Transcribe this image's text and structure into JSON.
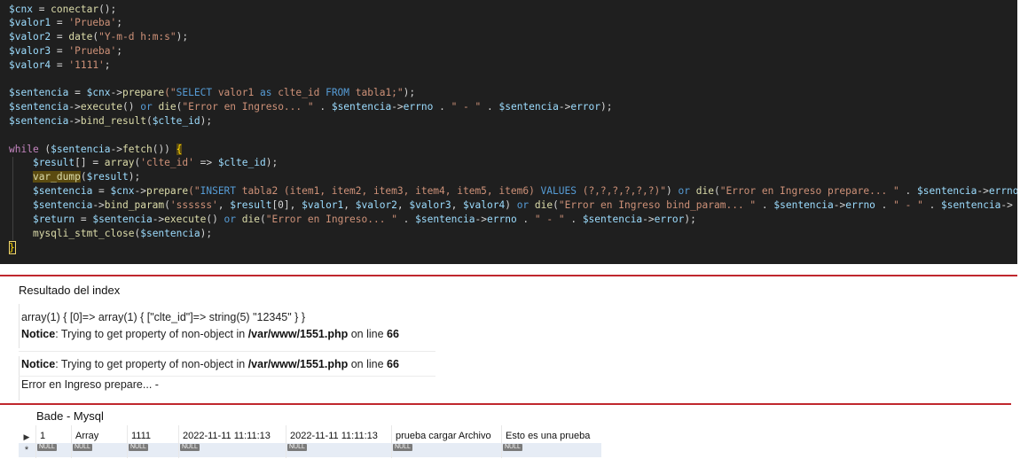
{
  "editor": {
    "lines": {
      "l1": [
        {
          "t": "$cnx",
          "c": "v"
        },
        {
          "t": " = ",
          "c": "o"
        },
        {
          "t": "conectar",
          "c": "f"
        },
        {
          "t": "();",
          "c": "o"
        }
      ],
      "l2": [
        {
          "t": "$valor1",
          "c": "v"
        },
        {
          "t": " = ",
          "c": "o"
        },
        {
          "t": "'Prueba'",
          "c": "s"
        },
        {
          "t": ";",
          "c": "o"
        }
      ],
      "l3": [
        {
          "t": "$valor2",
          "c": "v"
        },
        {
          "t": " = ",
          "c": "o"
        },
        {
          "t": "date",
          "c": "f"
        },
        {
          "t": "(",
          "c": "o"
        },
        {
          "t": "\"Y-m-d h:m:s\"",
          "c": "s"
        },
        {
          "t": ");",
          "c": "o"
        }
      ],
      "l4": [
        {
          "t": "$valor3",
          "c": "v"
        },
        {
          "t": " = ",
          "c": "o"
        },
        {
          "t": "'Prueba'",
          "c": "s"
        },
        {
          "t": ";",
          "c": "o"
        }
      ],
      "l5": [
        {
          "t": "$valor4",
          "c": "v"
        },
        {
          "t": " = ",
          "c": "o"
        },
        {
          "t": "'1111'",
          "c": "s"
        },
        {
          "t": ";",
          "c": "o"
        }
      ],
      "l6": [
        {
          "t": "$sentencia",
          "c": "v"
        },
        {
          "t": " = ",
          "c": "o"
        },
        {
          "t": "$cnx",
          "c": "v"
        },
        {
          "t": "->",
          "c": "o"
        },
        {
          "t": "prepare",
          "c": "f"
        },
        {
          "t": "(\"",
          "c": "s"
        },
        {
          "t": "SELECT",
          "c": "b"
        },
        {
          "t": " valor1 ",
          "c": "s"
        },
        {
          "t": "as",
          "c": "b"
        },
        {
          "t": " clte_id ",
          "c": "s"
        },
        {
          "t": "FROM",
          "c": "b"
        },
        {
          "t": " tabla1;\"",
          "c": "s"
        },
        {
          "t": ");",
          "c": "o"
        }
      ],
      "l7": [
        {
          "t": "$sentencia",
          "c": "v"
        },
        {
          "t": "->",
          "c": "o"
        },
        {
          "t": "execute",
          "c": "f"
        },
        {
          "t": "() ",
          "c": "o"
        },
        {
          "t": "or",
          "c": "b"
        },
        {
          "t": " ",
          "c": "o"
        },
        {
          "t": "die",
          "c": "f"
        },
        {
          "t": "(",
          "c": "o"
        },
        {
          "t": "\"Error en Ingreso... \"",
          "c": "s"
        },
        {
          "t": " . ",
          "c": "o"
        },
        {
          "t": "$sentencia",
          "c": "v"
        },
        {
          "t": "->",
          "c": "o"
        },
        {
          "t": "errno",
          "c": "v"
        },
        {
          "t": " . ",
          "c": "o"
        },
        {
          "t": "\" - \"",
          "c": "s"
        },
        {
          "t": " . ",
          "c": "o"
        },
        {
          "t": "$sentencia",
          "c": "v"
        },
        {
          "t": "->",
          "c": "o"
        },
        {
          "t": "error",
          "c": "v"
        },
        {
          "t": ");",
          "c": "o"
        }
      ],
      "l8": [
        {
          "t": "$sentencia",
          "c": "v"
        },
        {
          "t": "->",
          "c": "o"
        },
        {
          "t": "bind_result",
          "c": "f"
        },
        {
          "t": "(",
          "c": "o"
        },
        {
          "t": "$clte_id",
          "c": "v"
        },
        {
          "t": ");",
          "c": "o"
        }
      ],
      "l9": [
        {
          "t": "while",
          "c": "k"
        },
        {
          "t": " (",
          "c": "o"
        },
        {
          "t": "$sentencia",
          "c": "v"
        },
        {
          "t": "->",
          "c": "o"
        },
        {
          "t": "fetch",
          "c": "f"
        },
        {
          "t": "()) ",
          "c": "o"
        },
        {
          "t": "{",
          "c": "yl hl"
        }
      ],
      "l10": [
        {
          "t": "    ",
          "c": "o"
        },
        {
          "t": "$result",
          "c": "v"
        },
        {
          "t": "[] = ",
          "c": "o"
        },
        {
          "t": "array",
          "c": "f"
        },
        {
          "t": "(",
          "c": "o"
        },
        {
          "t": "'clte_id'",
          "c": "s"
        },
        {
          "t": " => ",
          "c": "o"
        },
        {
          "t": "$clte_id",
          "c": "v"
        },
        {
          "t": ");",
          "c": "o"
        }
      ],
      "l11": [
        {
          "t": "    ",
          "c": "o"
        },
        {
          "t": "var_dump",
          "c": "f hl"
        },
        {
          "t": "(",
          "c": "o"
        },
        {
          "t": "$result",
          "c": "v"
        },
        {
          "t": ");",
          "c": "o"
        }
      ],
      "l12": [
        {
          "t": "    ",
          "c": "o"
        },
        {
          "t": "$sentencia",
          "c": "v"
        },
        {
          "t": " = ",
          "c": "o"
        },
        {
          "t": "$cnx",
          "c": "v"
        },
        {
          "t": "->",
          "c": "o"
        },
        {
          "t": "prepare",
          "c": "f"
        },
        {
          "t": "(\"",
          "c": "s"
        },
        {
          "t": "INSERT",
          "c": "b"
        },
        {
          "t": " tabla2 (item1, item2, item3, item4, item5, item6) ",
          "c": "s"
        },
        {
          "t": "VALUES",
          "c": "b"
        },
        {
          "t": " (?,?,?,?,?,?)\"",
          "c": "s"
        },
        {
          "t": ") ",
          "c": "o"
        },
        {
          "t": "or",
          "c": "b"
        },
        {
          "t": " ",
          "c": "o"
        },
        {
          "t": "die",
          "c": "f"
        },
        {
          "t": "(",
          "c": "o"
        },
        {
          "t": "\"Error en Ingreso prepare... \"",
          "c": "s"
        },
        {
          "t": " . ",
          "c": "o"
        },
        {
          "t": "$sentencia",
          "c": "v"
        },
        {
          "t": "->",
          "c": "o"
        },
        {
          "t": "errno",
          "c": "v"
        },
        {
          "t": " . ",
          "c": "o"
        },
        {
          "t": "\" - \"",
          "c": "s"
        }
      ],
      "l13": [
        {
          "t": "    ",
          "c": "o"
        },
        {
          "t": "$sentencia",
          "c": "v"
        },
        {
          "t": "->",
          "c": "o"
        },
        {
          "t": "bind_param",
          "c": "f"
        },
        {
          "t": "(",
          "c": "o"
        },
        {
          "t": "'ssssss'",
          "c": "s"
        },
        {
          "t": ", ",
          "c": "o"
        },
        {
          "t": "$result",
          "c": "v"
        },
        {
          "t": "[0], ",
          "c": "o"
        },
        {
          "t": "$valor1",
          "c": "v"
        },
        {
          "t": ", ",
          "c": "o"
        },
        {
          "t": "$valor2",
          "c": "v"
        },
        {
          "t": ", ",
          "c": "o"
        },
        {
          "t": "$valor3",
          "c": "v"
        },
        {
          "t": ", ",
          "c": "o"
        },
        {
          "t": "$valor4",
          "c": "v"
        },
        {
          "t": ") ",
          "c": "o"
        },
        {
          "t": "or",
          "c": "b"
        },
        {
          "t": " ",
          "c": "o"
        },
        {
          "t": "die",
          "c": "f"
        },
        {
          "t": "(",
          "c": "o"
        },
        {
          "t": "\"Error en Ingreso bind_param... \"",
          "c": "s"
        },
        {
          "t": " . ",
          "c": "o"
        },
        {
          "t": "$sentencia",
          "c": "v"
        },
        {
          "t": "->",
          "c": "o"
        },
        {
          "t": "errno",
          "c": "v"
        },
        {
          "t": " . ",
          "c": "o"
        },
        {
          "t": "\" - \"",
          "c": "s"
        },
        {
          "t": " . ",
          "c": "o"
        },
        {
          "t": "$sentencia",
          "c": "v"
        },
        {
          "t": "->",
          "c": "o"
        }
      ],
      "l14": [
        {
          "t": "    ",
          "c": "o"
        },
        {
          "t": "$return",
          "c": "v"
        },
        {
          "t": " = ",
          "c": "o"
        },
        {
          "t": "$sentencia",
          "c": "v"
        },
        {
          "t": "->",
          "c": "o"
        },
        {
          "t": "execute",
          "c": "f"
        },
        {
          "t": "() ",
          "c": "o"
        },
        {
          "t": "or",
          "c": "b"
        },
        {
          "t": " ",
          "c": "o"
        },
        {
          "t": "die",
          "c": "f"
        },
        {
          "t": "(",
          "c": "o"
        },
        {
          "t": "\"Error en Ingreso... \"",
          "c": "s"
        },
        {
          "t": " . ",
          "c": "o"
        },
        {
          "t": "$sentencia",
          "c": "v"
        },
        {
          "t": "->",
          "c": "o"
        },
        {
          "t": "errno",
          "c": "v"
        },
        {
          "t": " . ",
          "c": "o"
        },
        {
          "t": "\" - \"",
          "c": "s"
        },
        {
          "t": " . ",
          "c": "o"
        },
        {
          "t": "$sentencia",
          "c": "v"
        },
        {
          "t": "->",
          "c": "o"
        },
        {
          "t": "error",
          "c": "v"
        },
        {
          "t": ");",
          "c": "o"
        }
      ],
      "l15": [
        {
          "t": "    ",
          "c": "o"
        },
        {
          "t": "mysqli_stmt_close",
          "c": "f"
        },
        {
          "t": "(",
          "c": "o"
        },
        {
          "t": "$sentencia",
          "c": "v"
        },
        {
          "t": ");",
          "c": "o"
        }
      ],
      "l16": [
        {
          "t": "}",
          "c": "yl"
        }
      ]
    }
  },
  "output": {
    "title": "Resultado del index",
    "var_dump": "array(1) { [0]=> array(1) { [\"clte_id\"]=> string(5) \"12345\" } }",
    "notice_label": "Notice",
    "notice_msg": ": Trying to get property of non-object in ",
    "notice_path": "/var/www/1551.php",
    "notice_on": " on line ",
    "notice_line": "66",
    "error": "Error en Ingreso prepare... -"
  },
  "db": {
    "title": "Bade - Mysql",
    "row": [
      "1",
      "Array",
      "1111",
      "2022-11-11 11:11:13",
      "2022-11-11 11:11:13",
      "prueba cargar Archivo",
      "Esto es una prueba"
    ],
    "null_label": "NULL",
    "row_marker": "▶",
    "new_marker": "*"
  }
}
